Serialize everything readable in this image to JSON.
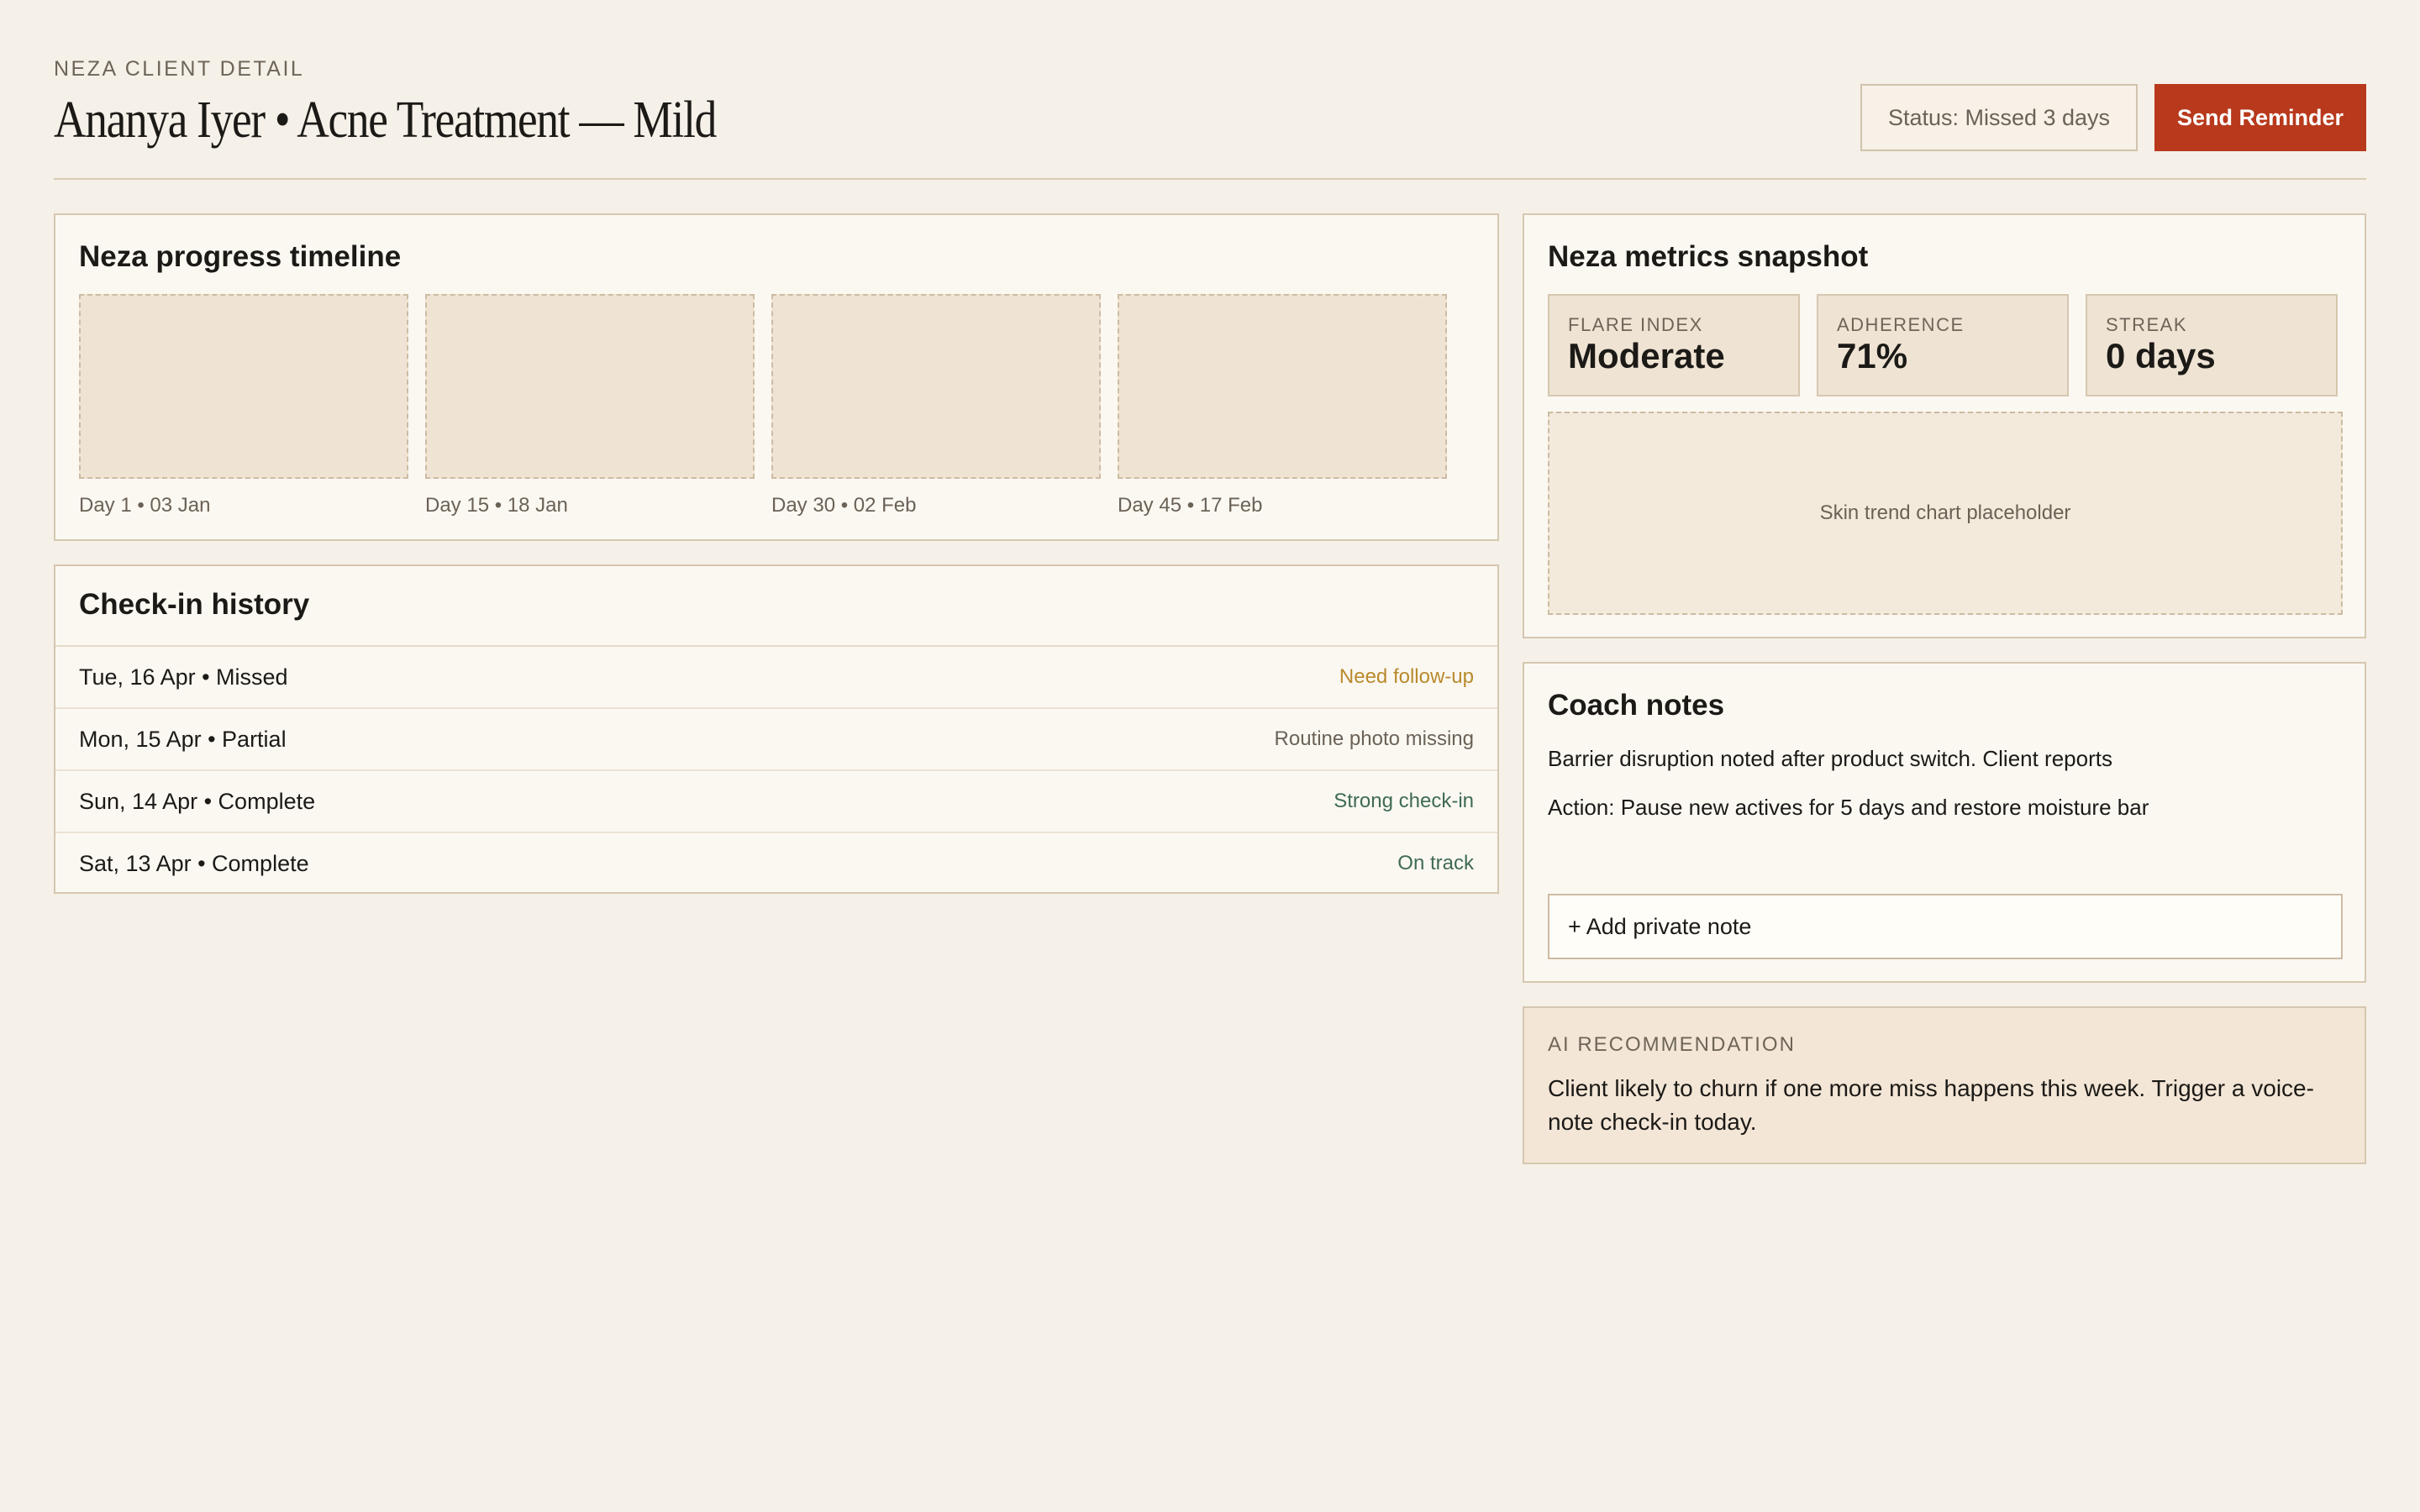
{
  "header": {
    "eyebrow": "NEZA CLIENT DETAIL",
    "title": "Ananya Iyer • Acne Treatment — Mild",
    "status": "Status: Missed 3 days",
    "send_label": "Send Reminder"
  },
  "timeline": {
    "title": "Neza progress timeline",
    "items": [
      {
        "label": "Day 1 • 03 Jan"
      },
      {
        "label": "Day 15 • 18 Jan"
      },
      {
        "label": "Day 30 • 02 Feb"
      },
      {
        "label": "Day 45 • 17 Feb"
      }
    ]
  },
  "history": {
    "title": "Check-in history",
    "rows": [
      {
        "left": "Tue, 16 Apr • Missed",
        "right": "Need follow-up",
        "color": "#b98a2c"
      },
      {
        "left": "Mon, 15 Apr • Partial",
        "right": "Routine photo missing",
        "color": "#6b6256"
      },
      {
        "left": "Sun, 14 Apr • Complete",
        "right": "Strong check-in",
        "color": "#3f6b52"
      },
      {
        "left": "Sat, 13 Apr • Complete",
        "right": "On track",
        "color": "#3f6b52"
      }
    ]
  },
  "metrics": {
    "title": "Neza metrics snapshot",
    "tiles": [
      {
        "label": "FLARE INDEX",
        "value": "Moderate"
      },
      {
        "label": "ADHERENCE",
        "value": "71%"
      },
      {
        "label": "STREAK",
        "value": "0 days"
      }
    ],
    "chart_placeholder": "Skin trend chart placeholder"
  },
  "notes": {
    "title": "Coach notes",
    "lines": [
      "Barrier disruption noted after product switch. Client reports",
      "Action: Pause new actives for 5 days and restore moisture bar"
    ],
    "add_label": "+ Add private note"
  },
  "ai": {
    "label": "AI RECOMMENDATION",
    "text": "Client likely to churn if one more miss happens this week. Trigger a voice-note check-in today."
  }
}
